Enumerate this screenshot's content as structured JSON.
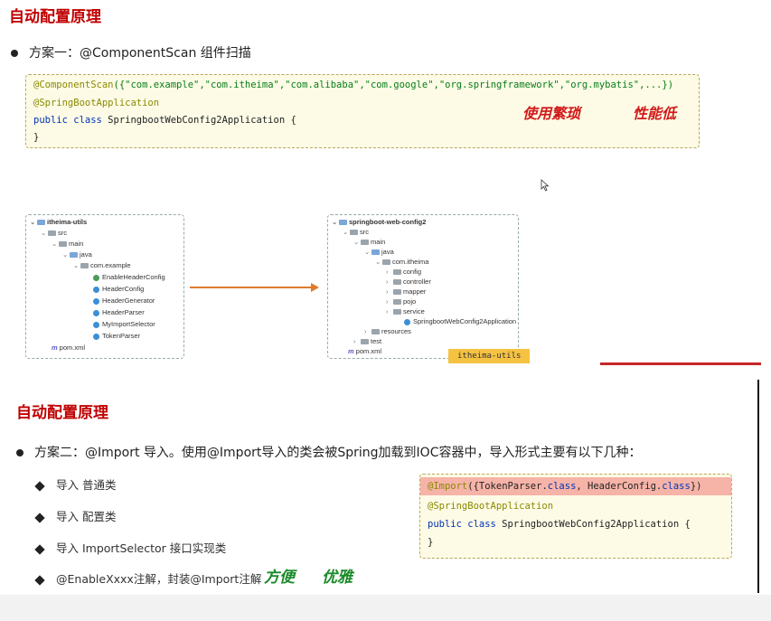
{
  "slide1": {
    "title": "自动配置原理",
    "bullet": "方案一：@ComponentScan 组件扫描",
    "code": {
      "line1_anno": "@ComponentScan",
      "line1_rest": "({\"com.example\",\"com.itheima\",\"com.alibaba\",\"com.google\",\"org.springframework\",\"org.mybatis\",...})",
      "line2": "@SpringBootApplication",
      "line3_kw": "public class",
      "line3_rest": " SpringbootWebConfig2Application {",
      "line4": "}"
    },
    "handwriting": [
      "使用繁琐",
      "性能低"
    ],
    "left_tree": {
      "root": "itheima-utils",
      "items": [
        "src",
        "main",
        "java",
        "com.example",
        "EnableHeaderConfig",
        "HeaderConfig",
        "HeaderGenerator",
        "HeaderParser",
        "MyImportSelector",
        "TokenParser",
        "pom.xml"
      ]
    },
    "right_tree": {
      "root": "springboot-web-config2",
      "items": [
        "src",
        "main",
        "java",
        "com.itheima",
        "config",
        "controller",
        "mapper",
        "pojo",
        "service",
        "SpringbootWebConfig2Application",
        "resources",
        "test",
        "pom.xml"
      ]
    },
    "badge": "itheima-utils",
    "pom_icon": "m"
  },
  "slide2": {
    "title": "自动配置原理",
    "bullet": "方案二：@Import 导入。使用@Import导入的类会被Spring加载到IOC容器中，导入形式主要有以下几种：",
    "subs": [
      "导入 普通类",
      "导入 配置类",
      "导入 ImportSelector 接口实现类",
      "@EnableXxxx注解，封装@Import注解"
    ],
    "handwriting": [
      "方便",
      "优雅"
    ],
    "code": {
      "line1_anno": "@Import",
      "line1_a": "({TokenParser.",
      "line1_cls1": "class",
      "line1_b": ", HeaderConfig.",
      "line1_cls2": "class",
      "line1_c": "})",
      "line2": "@SpringBootApplication",
      "line3_kw": "public class",
      "line3_rest": " SpringbootWebConfig2Application {",
      "line4": "}"
    }
  },
  "colors": {
    "title": "#c00000",
    "code_bg": "#fdfbe6",
    "import_highlight": "#f6b3a8",
    "handwriting_red": "#d21a1a",
    "handwriting_green": "#1b8a2a",
    "arrow": "#e07a2a",
    "badge": "#f5c242"
  }
}
